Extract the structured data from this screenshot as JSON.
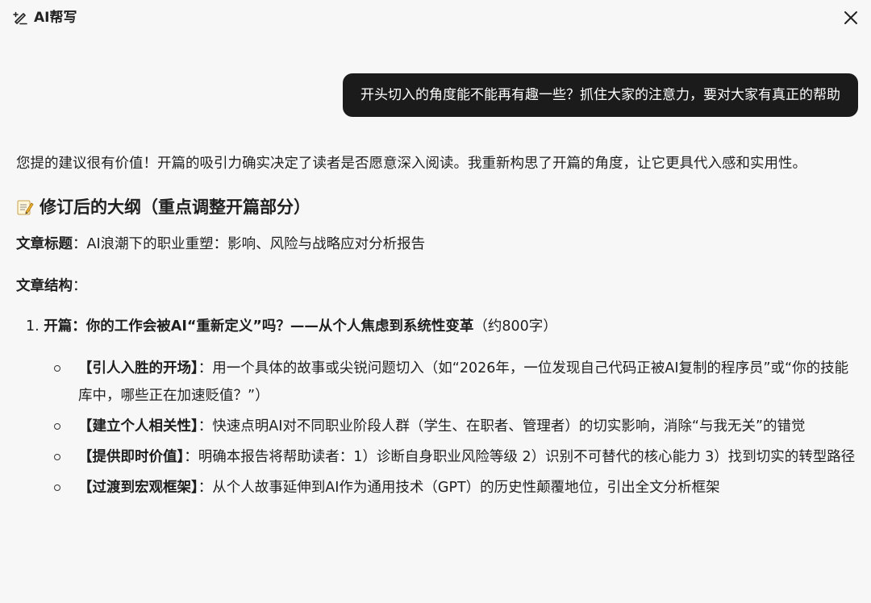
{
  "header": {
    "title": "AI帮写",
    "icon": "ai-write-icon",
    "close_icon": "close-icon"
  },
  "chat": {
    "user_message": "开头切入的角度能不能再有趣一些？抓住大家的注意力，要对大家有真正的帮助"
  },
  "response": {
    "intro": "您提的建议很有价值！开篇的吸引力确实决定了读者是否愿意深入阅读。我重新构思了开篇的角度，让它更具代入感和实用性。",
    "heading": "修订后的大纲（重点调整开篇部分）",
    "heading_icon": "memo-icon",
    "title_label": "文章标题",
    "title_sep": "：",
    "title_value": "AI浪潮下的职业重塑：影响、风险与战略应对分析报告",
    "structure_label": "文章结构",
    "structure_sep": "：",
    "sections": [
      {
        "number": "1.",
        "title": "开篇：你的工作会被AI“重新定义”吗？——从个人焦虑到系统性变革",
        "note": "（约800字）",
        "items": [
          {
            "label": "【引人入胜的开场】",
            "sep": "：",
            "text": "用一个具体的故事或尖锐问题切入（如“2026年，一位发现自己代码正被AI复制的程序员”或“你的技能库中，哪些正在加速贬值？”）"
          },
          {
            "label": "【建立个人相关性】",
            "sep": "：",
            "text": "快速点明AI对不同职业阶段人群（学生、在职者、管理者）的切实影响，消除“与我无关”的错觉"
          },
          {
            "label": "【提供即时价值】",
            "sep": "：",
            "text": "明确本报告将帮助读者：1）诊断自身职业风险等级 2）识别不可替代的核心能力 3）找到切实的转型路径"
          },
          {
            "label": "【过渡到宏观框架】",
            "sep": "：",
            "text": "从个人故事延伸到AI作为通用技术（GPT）的历史性颠覆地位，引出全文分析框架"
          }
        ]
      }
    ]
  },
  "colors": {
    "background": "#f7f7f8",
    "bubble": "#1b1b1b",
    "text": "#1f1f1f"
  }
}
